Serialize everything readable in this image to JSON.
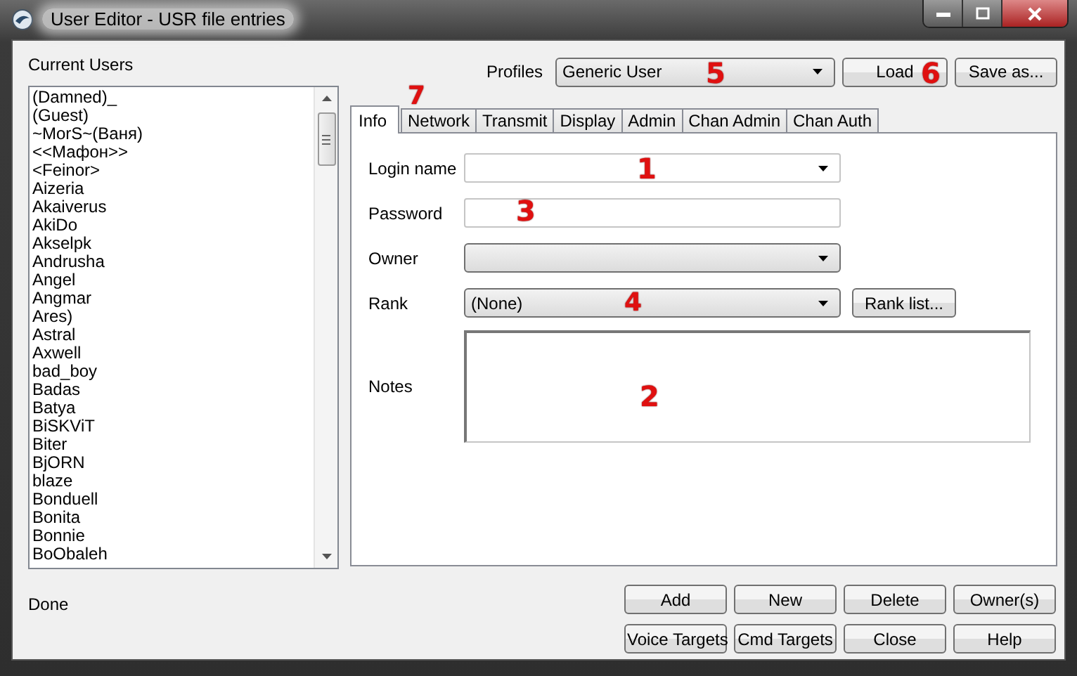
{
  "window": {
    "title": "User Editor - USR file entries"
  },
  "users_label": "Current Users",
  "users": [
    "(Damned)_",
    "(Guest)",
    "~MorS~(Ваня)",
    "<<Мафон>>",
    "<Feinor>",
    "Aizeria",
    "Akaiverus",
    "AkiDo",
    "Akselpk",
    "Andrusha",
    "Angel",
    "Angmar",
    "Ares)",
    "Astral",
    "Axwell",
    "bad_boy",
    "Badas",
    "Batya",
    "BiSKViT",
    "Biter",
    "BjORN",
    "blaze",
    "Bonduell",
    "Bonita",
    "Bonnie",
    "BoObaleh"
  ],
  "profiles": {
    "label": "Profiles",
    "value": "Generic User",
    "marker": "5"
  },
  "profile_buttons": [
    {
      "label": "Load",
      "marker": "6"
    },
    {
      "label": "Save as..."
    }
  ],
  "tabs": [
    {
      "label": "Info",
      "selected": true
    },
    {
      "label": "Network",
      "selected": false,
      "marker": "7"
    },
    {
      "label": "Transmit",
      "selected": false
    },
    {
      "label": "Display",
      "selected": false
    },
    {
      "label": "Admin",
      "selected": false
    },
    {
      "label": "Chan Admin",
      "selected": false
    },
    {
      "label": "Chan Auth",
      "selected": false
    }
  ],
  "fields": [
    {
      "label": "Login name",
      "kind": "editable-combo",
      "marker": "1"
    },
    {
      "label": "Password",
      "kind": "text",
      "marker": "3"
    },
    {
      "label": "Owner",
      "kind": "combo"
    },
    {
      "label": "Rank",
      "kind": "combo",
      "value": "(None)",
      "marker": "4",
      "button": "Rank list..."
    },
    {
      "label": "Notes",
      "kind": "memo",
      "marker": "2"
    }
  ],
  "status": "Done",
  "buttons": [
    "Add",
    "New",
    "Delete",
    "Owner(s)",
    "Voice Targets",
    "Cmd Targets",
    "Close",
    "Help"
  ]
}
